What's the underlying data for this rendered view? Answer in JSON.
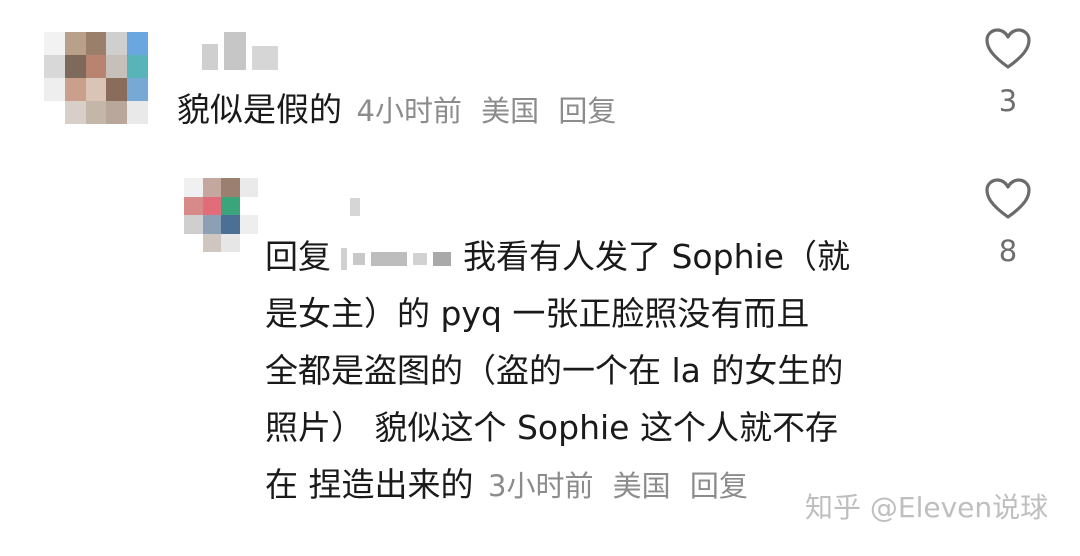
{
  "comments": [
    {
      "text": "貌似是假的",
      "time": "4小时前",
      "location": "美国",
      "reply_label": "回复",
      "likes": "3",
      "avatar_colors": [
        "#f2f2f2",
        "#b9a08a",
        "#9a7f6b",
        "#cfcfcf",
        "#6aa7e0",
        "#d8d8d8",
        "#7e6a5a",
        "#b8836f",
        "#c7c0ba",
        "#58b4b8",
        "#eeeeee",
        "#caa08d",
        "#d9c4b6",
        "#8a6c5a",
        "#77a9d4",
        "#ffffff",
        "#d8d0c8",
        "#c5b6aa",
        "#b8a79a",
        "#e9e9e9"
      ]
    },
    {
      "lines": [
        "回复",
        "我看有人发了 Sophie（就",
        "是女主）的 pyq 一张正脸照没有而且",
        "全都是盗图的（盗的一个在 la 的女生的",
        "照片） 貌似这个 Sophie 这个人就不存",
        "在 捏造出来的"
      ],
      "time": "3小时前",
      "location": "美国",
      "reply_label": "回复",
      "likes": "8",
      "avatar_colors": [
        "#f0f0f0",
        "#c4a8a0",
        "#9b8070",
        "#eaeaea",
        "#d78a8a",
        "#e26d7a",
        "#3aa57a",
        "#ffffff",
        "#cfcfcf",
        "#8ba0b5",
        "#4c6f95",
        "#eeeeee",
        "#ffffff",
        "#cfc6c0",
        "#e6e6e6",
        "#ffffff"
      ]
    }
  ],
  "watermark": "知乎 @Eleven说球"
}
